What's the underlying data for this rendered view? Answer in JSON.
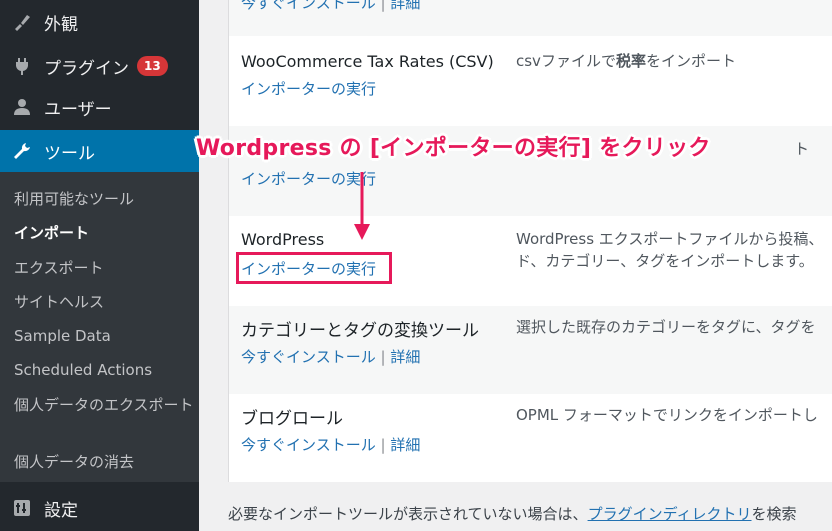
{
  "sidebar": {
    "menu": [
      {
        "label": "外観",
        "icon": "paintbrush-icon"
      },
      {
        "label": "プラグイン",
        "icon": "plugin-icon",
        "badge": "13"
      },
      {
        "label": "ユーザー",
        "icon": "user-icon"
      },
      {
        "label": "ツール",
        "icon": "wrench-icon",
        "current": true
      }
    ],
    "submenu": [
      {
        "label": "利用可能なツール"
      },
      {
        "label": "インポート",
        "current": true
      },
      {
        "label": "エクスポート"
      },
      {
        "label": "サイトヘルス"
      },
      {
        "label": "Sample Data"
      },
      {
        "label": "Scheduled Actions"
      },
      {
        "label": "個人データのエクスポート"
      },
      {
        "label": "個人データの消去"
      }
    ],
    "settings": {
      "label": "設定",
      "icon": "settings-icon"
    }
  },
  "importers": {
    "top_partial": {
      "link": "今すぐインストール",
      "detail": "詳細"
    },
    "rows": [
      {
        "name": "WooCommerce Tax Rates (CSV)",
        "link": "インポーターの実行",
        "desc": "csvファイルで",
        "desc_bold": "税率",
        "desc_tail": "をインポート"
      },
      {
        "name": "",
        "link": "インポーターの実行",
        "desc": "ト"
      },
      {
        "name": "WordPress",
        "link": "インポーターの実行",
        "desc": "WordPress エクスポートファイルから投稿、",
        "desc2": "ド、カテゴリー、タグをインポートします。"
      },
      {
        "name": "カテゴリーとタグの変換ツール",
        "link": "今すぐインストール",
        "detail": "詳細",
        "desc": "選択した既存のカテゴリーをタグに、タグを"
      },
      {
        "name": "ブログロール",
        "link": "今すぐインストール",
        "detail": "詳細",
        "desc": "OPML フォーマットでリンクをインポートし"
      }
    ]
  },
  "footer": {
    "text": "必要なインポートツールが表示されていない場合は、",
    "link": "プラグインディレクトリ",
    "tail": "を検索"
  },
  "annotation": {
    "text": "Wordpress の [インポーターの実行] をクリック"
  },
  "colors": {
    "accent": "#e6195a",
    "current_menu": "#0073aa",
    "link": "#2271b1"
  }
}
